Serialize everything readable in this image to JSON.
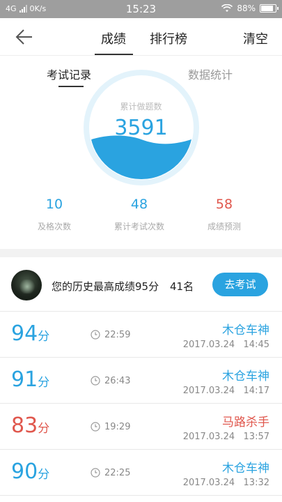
{
  "status_bar": {
    "network": "4G",
    "speed": "0K/s",
    "time": "15:23",
    "battery": "88%",
    "battery_level": 0.88,
    "icons": [
      "signal-icon",
      "wifi-icon",
      "battery-icon"
    ]
  },
  "nav": {
    "tabs": [
      "成绩",
      "排行榜"
    ],
    "active_tab": "成绩",
    "right_action": "清空",
    "back_icon": "back-arrow-icon"
  },
  "subtabs": {
    "items": [
      "考试记录",
      "数据统计"
    ],
    "active": "考试记录"
  },
  "summary": {
    "gauge_label": "累计做题数",
    "gauge_value": "3591",
    "stats": [
      {
        "value": "10",
        "label": "及格次数",
        "color": "#2aa3e0"
      },
      {
        "value": "48",
        "label": "累计考试次数",
        "color": "#2aa3e0"
      },
      {
        "value": "58",
        "label": "成绩预测",
        "color": "#e0574d"
      }
    ]
  },
  "best": {
    "text": "您的历史最高成绩95分",
    "rank": "41名",
    "button": "去考试"
  },
  "records": [
    {
      "score": "94",
      "unit": "分",
      "duration": "22:59",
      "name": "木仓车神",
      "date": "2017.03.24",
      "time": "14:45",
      "color": "blue"
    },
    {
      "score": "91",
      "unit": "分",
      "duration": "26:43",
      "name": "木仓车神",
      "date": "2017.03.24",
      "time": "14:17",
      "color": "blue"
    },
    {
      "score": "83",
      "unit": "分",
      "duration": "19:29",
      "name": "马路杀手",
      "date": "2017.03.24",
      "time": "13:57",
      "color": "red"
    },
    {
      "score": "90",
      "unit": "分",
      "duration": "22:25",
      "name": "木仓车神",
      "date": "2017.03.24",
      "time": "13:32",
      "color": "blue"
    }
  ],
  "colors": {
    "accent": "#2aa3e0",
    "warn": "#e0574d"
  }
}
